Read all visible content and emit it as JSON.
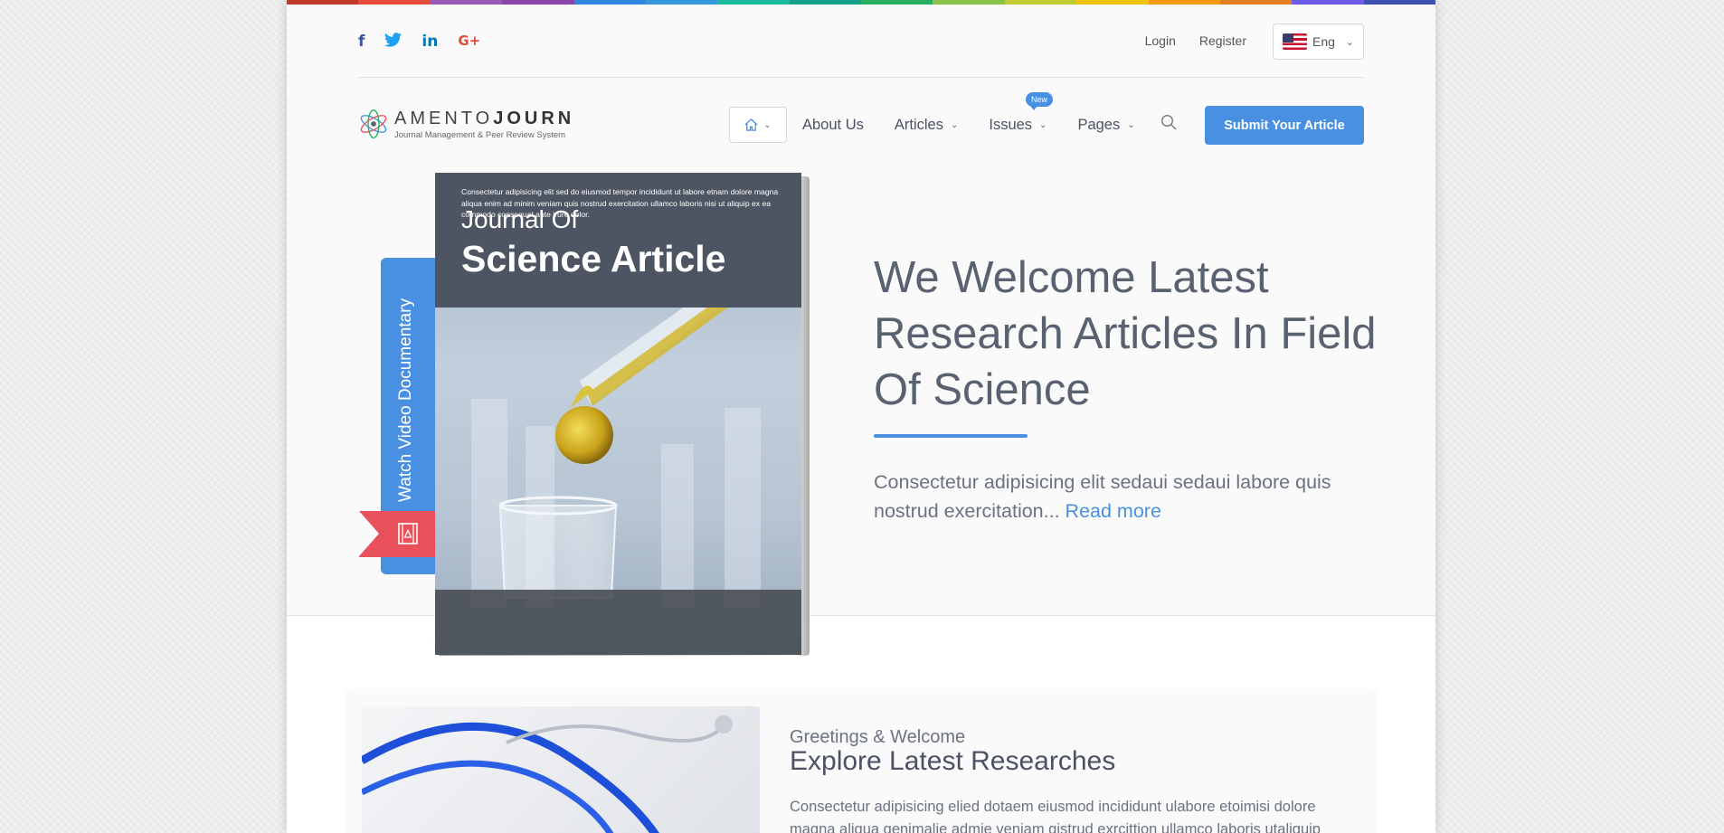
{
  "rainbow_colors": [
    "#c0392b",
    "#e74c3c",
    "#9b59b6",
    "#8e44ad",
    "#2e86de",
    "#3498db",
    "#1abc9c",
    "#16a085",
    "#27ae60",
    "#8bc34a",
    "#c0ca33",
    "#f1c40f",
    "#f39c12",
    "#e67e22",
    "#6c5ce7",
    "#3f51b5"
  ],
  "social": {
    "facebook": "f",
    "twitter": "t",
    "linkedin": "in",
    "googleplus": "G+"
  },
  "topbar": {
    "login": "Login",
    "register": "Register",
    "language": "Eng"
  },
  "logo": {
    "name_light": "AMENTO",
    "name_bold": "JOURN",
    "subtitle": "Journal Management & Peer Review System"
  },
  "nav": {
    "about": "About Us",
    "articles": "Articles",
    "issues": "Issues",
    "pages": "Pages",
    "new_badge": "New",
    "submit": "Submit Your Article"
  },
  "hero": {
    "video_label": "Watch Video Documentary",
    "book_title_small": "Journal Of",
    "book_title_big": "Science Article",
    "book_footer": "Consectetur adipisicing elit sed do eiusmod tempor incididunt ut labore etnam dolore magna aliqua enim ad minim veniam quis nostrud exercitation ullamco laboris nisi ut aliquip ex ea commodo consequat aute irure dolor.",
    "title": "We Welcome Latest Research Articles In Field Of Science",
    "description": "Consectetur adipisicing elit sedaui sedaui labore quis nostrud exercitation...",
    "read_more": "Read more"
  },
  "welcome": {
    "greeting": "Greetings & Welcome",
    "heading": "Explore Latest Researches",
    "description": "Consectetur adipisicing elied dotaem eiusmod incididunt ulabore etoimisi dolore magna aliqua genimalie admie veniam qistrud exrcittion ullamco laboris utaliquip"
  },
  "colors": {
    "accent": "#4a90e2",
    "ribbon": "#e8505b",
    "book_header": "#4e5562"
  }
}
